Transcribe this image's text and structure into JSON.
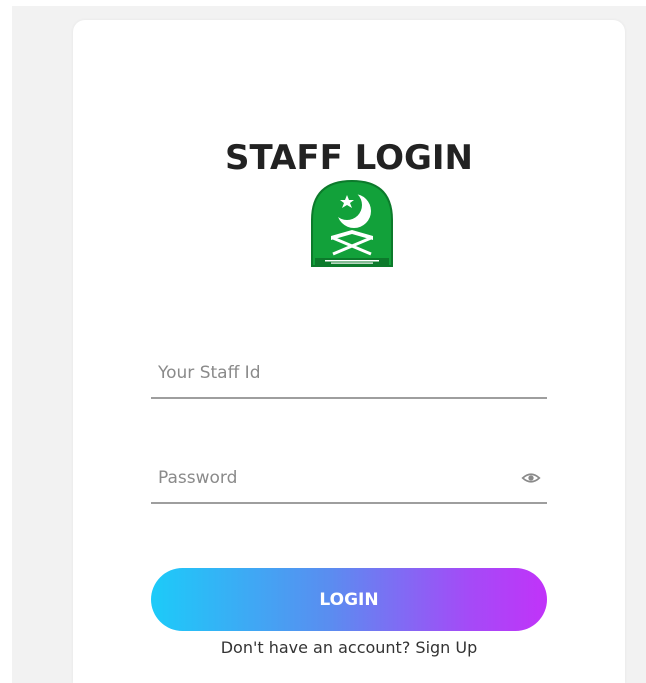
{
  "login": {
    "title": "STAFF LOGIN",
    "staff_id_placeholder": "Your Staff Id",
    "password_placeholder": "Password",
    "login_label": "LOGIN",
    "signup_prompt": "Don't have an account?",
    "signup_link": "Sign Up"
  },
  "icons": {
    "logo": "crescent-star-book-emblem",
    "password_toggle": "eye-icon"
  },
  "colors": {
    "title": "#222222",
    "logo_green": "#12a13a",
    "button_start": "#1ccbf9",
    "button_end": "#c133f9",
    "underline": "#9e9e9e",
    "page_bg": "#f2f2f2"
  }
}
